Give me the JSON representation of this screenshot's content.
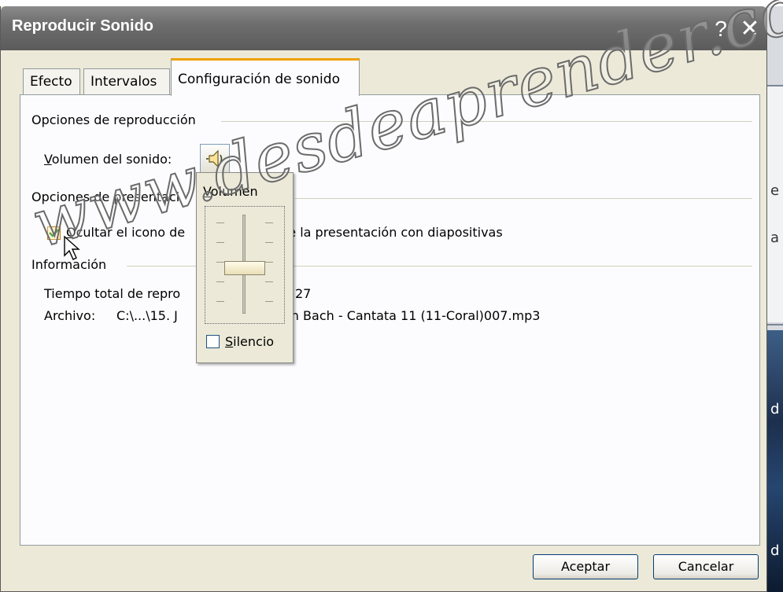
{
  "window": {
    "title": "Reproducir Sonido",
    "help_glyph": "?",
    "close_glyph": "✕"
  },
  "tabs": [
    {
      "label": "Efecto",
      "active": false
    },
    {
      "label": "Intervalos",
      "active": false
    },
    {
      "label": "Configuración de sonido",
      "active": true
    }
  ],
  "playback_options": {
    "title": "Opciones de reproducción",
    "volume_label_prefix": "",
    "volume_label_accel": "V",
    "volume_label_rest": "olumen del sonido:",
    "volume_icon": "speaker-icon"
  },
  "display_options": {
    "title": "Opciones de presentaci",
    "hide_icon": {
      "checked": true,
      "accel": "O",
      "label_part1": "cultar el icono de",
      "label_part2": "te la presentación con diapositivas"
    }
  },
  "information": {
    "title": "Información",
    "total_time_label": "Tiempo total de repro",
    "total_time_value": "27",
    "file_label": "Archivo:",
    "file_path_start": "C:\\...\\15. J",
    "file_path_end": "an Bach - Cantata 11 (11-Coral)007.mp3"
  },
  "volume_popup": {
    "title": "Volumen",
    "level": 0.45,
    "mute_label": "Silencio",
    "mute_accel": "S",
    "mute_rest": "ilencio",
    "mute_checked": false
  },
  "buttons": {
    "ok": "Aceptar",
    "cancel": "Cancelar"
  },
  "watermark": "www.desdeaprender.com",
  "side_letters": [
    "e",
    "a",
    "d",
    "d"
  ],
  "colors": {
    "title_bar": "#6e6e6e",
    "dialog_bg": "#ece9d8",
    "active_tab_accent": "#f0a000",
    "checkbox_accent": "#c57e14"
  }
}
